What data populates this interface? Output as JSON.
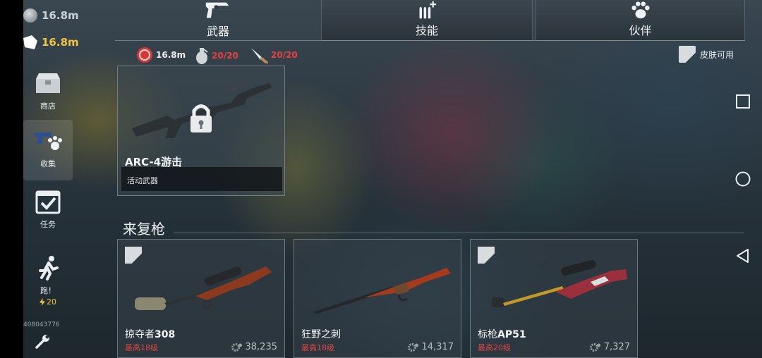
{
  "currency": {
    "silver": "16.8m",
    "gold": "16.8m"
  },
  "sidebar": {
    "items": [
      {
        "label": "商店",
        "icon": "shop-chest-icon"
      },
      {
        "label": "收集",
        "icon": "collection-gun-paw-icon",
        "active": true
      },
      {
        "label": "任务",
        "icon": "task-calendar-icon"
      },
      {
        "label": "跑！",
        "icon": "run-icon",
        "cost": "20"
      }
    ],
    "user_id": "408043776",
    "settings_icon": "wrench-icon"
  },
  "tabs": [
    {
      "label": "武器",
      "icon": "revolver-icon",
      "active": true
    },
    {
      "label": "技能",
      "icon": "bullets-plus-icon",
      "active": false
    },
    {
      "label": "伙伴",
      "icon": "paw-icon",
      "active": false
    }
  ],
  "resources": {
    "cash": "16.8m",
    "grenades": "20/20",
    "knives": "20/20"
  },
  "skin_available": "皮肤可用",
  "featured": {
    "name": "ARC-4游击",
    "subtitle": "活动武器",
    "locked": true
  },
  "section": {
    "title": "来复枪"
  },
  "rifles": [
    {
      "name_prefix": "掠夺者",
      "name_bold": "308",
      "level": "最高18级",
      "power": "38,235"
    },
    {
      "name_prefix": "狂野之刺",
      "name_bold": "",
      "level": "最高18级",
      "power": "14,317"
    },
    {
      "name_prefix": "标枪",
      "name_bold": "AP51",
      "level": "最高20级",
      "power": "7,327"
    }
  ],
  "colors": {
    "gold": "#f0c540",
    "red": "#e04545",
    "panel_border": "#aab4ba"
  }
}
